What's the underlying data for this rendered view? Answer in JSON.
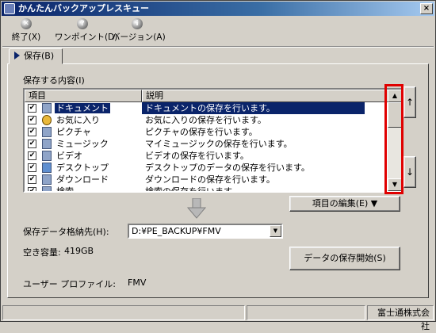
{
  "window": {
    "title": "かんたんバックアップレスキュー",
    "close_glyph": "×"
  },
  "toolbar": [
    {
      "label": "終了(X)",
      "icon": "exit-icon",
      "glyph": "✕"
    },
    {
      "label": "ワンポイント(D)",
      "icon": "help-icon",
      "glyph": "?"
    },
    {
      "label": "バージョン(A)",
      "icon": "info-icon",
      "glyph": "i"
    }
  ],
  "tab": {
    "label": "保存(B)"
  },
  "list": {
    "group_label": "保存する内容(I)",
    "columns": [
      "項目",
      "説明"
    ],
    "rows": [
      {
        "name": "ドキュメント",
        "desc": "ドキュメントの保存を行います。",
        "checked": true,
        "selected": true,
        "icon": "folder-icon"
      },
      {
        "name": "お気に入り",
        "desc": "お気に入りの保存を行います。",
        "checked": true,
        "selected": false,
        "icon": "favorites-icon"
      },
      {
        "name": "ピクチャ",
        "desc": "ピクチャの保存を行います。",
        "checked": true,
        "selected": false,
        "icon": "folder-icon"
      },
      {
        "name": "ミュージック",
        "desc": "マイミュージックの保存を行います。",
        "checked": true,
        "selected": false,
        "icon": "folder-icon"
      },
      {
        "name": "ビデオ",
        "desc": "ビデオの保存を行います。",
        "checked": true,
        "selected": false,
        "icon": "folder-icon"
      },
      {
        "name": "デスクトップ",
        "desc": "デスクトップのデータの保存を行います。",
        "checked": true,
        "selected": false,
        "icon": "desktop-icon"
      },
      {
        "name": "ダウンロード",
        "desc": "ダウンロードの保存を行います。",
        "checked": true,
        "selected": false,
        "icon": "folder-icon"
      },
      {
        "name": "検索",
        "desc": "検索の保存を行います。",
        "checked": true,
        "selected": false,
        "icon": "folder-icon"
      }
    ],
    "check_glyph": "✔"
  },
  "side_buttons": {
    "up": "↑",
    "down": "↓"
  },
  "edit_button": {
    "label": "項目の編集(E) ▼"
  },
  "destination": {
    "label": "保存データ格納先(H):",
    "value": "D:¥PE_BACKUP¥FMV",
    "dropdown_glyph": "▼"
  },
  "free_space": {
    "label": "空き容量:",
    "value": "419GB"
  },
  "start_button": {
    "label": "データの保存開始(S)"
  },
  "profile": {
    "label": "ユーザー プロファイル:",
    "value": "FMV"
  },
  "status": {
    "company": "富士通株式会社"
  },
  "colors": {
    "highlight": "#e00000",
    "selection": "#0a246a",
    "title_bar": "#0a246a"
  }
}
